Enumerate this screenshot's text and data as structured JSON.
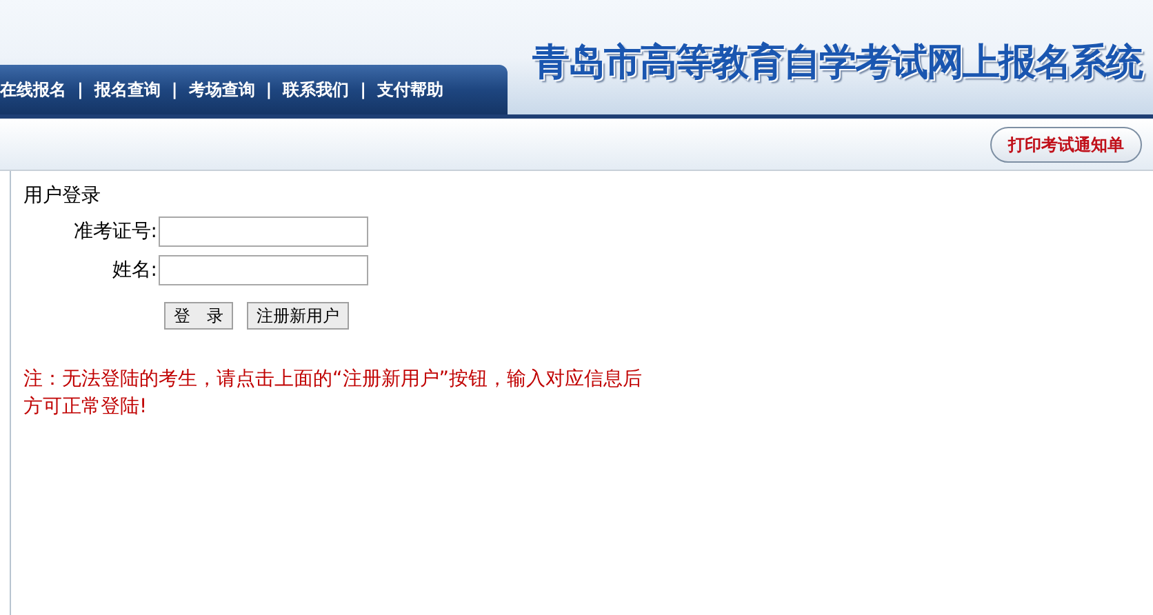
{
  "header": {
    "title": "青岛市高等教育自学考试网上报名系统",
    "nav": [
      {
        "label": "在线报名"
      },
      {
        "label": "报名查询"
      },
      {
        "label": "考场查询"
      },
      {
        "label": "联系我们"
      },
      {
        "label": "支付帮助"
      }
    ],
    "nav_separator": "|"
  },
  "toolbar": {
    "print_button": "打印考试通知单"
  },
  "login": {
    "heading": "用户登录",
    "fields": [
      {
        "label": "准考证号:"
      },
      {
        "label": "姓名:"
      }
    ],
    "buttons": [
      "登　录",
      "注册新用户"
    ],
    "note": "注：无法登陆的考生，请点击上面的“注册新用户”按钮，输入对应信息后方可正常登陆!"
  }
}
